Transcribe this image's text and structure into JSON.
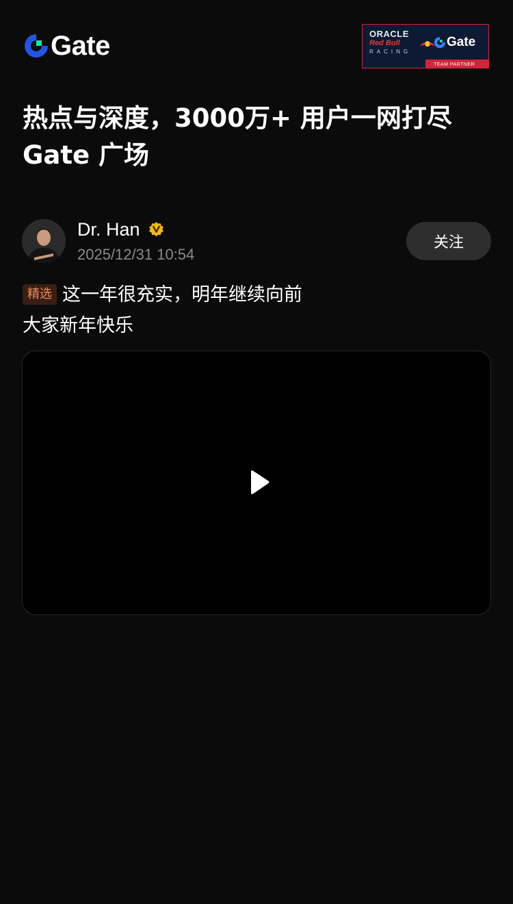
{
  "header": {
    "logo_text": "Gate",
    "partner_badge": {
      "oracle": "ORACLE",
      "red_bull": "Red Bull",
      "racing": "RACING",
      "gate": "Gate",
      "team_partner": "TEAM PARTNER"
    }
  },
  "headline": {
    "line1": "热点与深度，3000万+ 用户一网打尽",
    "line2": "Gate 广场"
  },
  "post": {
    "author_name": "Dr. Han",
    "timestamp": "2025/12/31 10:54",
    "follow_label": "关注",
    "tag": "精选",
    "text_line1": "这一年很充实，明年继续向前",
    "text_line2": "大家新年快乐"
  },
  "colors": {
    "background": "#0b0b0b",
    "brand_blue": "#2354e6",
    "brand_teal": "#17e6a1",
    "verified_gold": "#f0b90b",
    "tag_text": "#f08c5c",
    "tag_bg": "#3a1e14",
    "timestamp": "#8a8a8a"
  },
  "icons": {
    "logo": "gate-logo-icon",
    "verified": "verified-badge-icon",
    "play": "play-icon"
  }
}
